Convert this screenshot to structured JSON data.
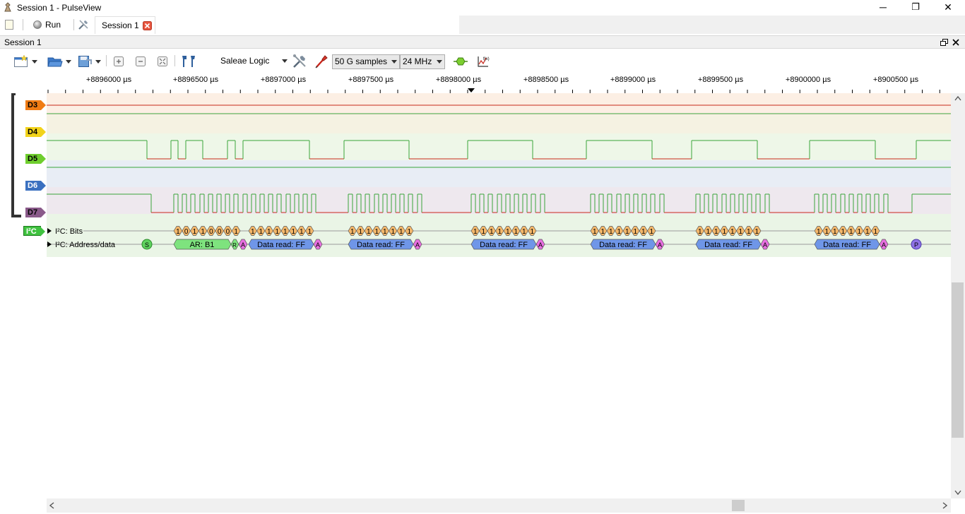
{
  "window": {
    "title": "Session 1 - PulseView",
    "minimize_glyph": "─",
    "restore_glyph": "❐",
    "close_glyph": "✕"
  },
  "tabbar": {
    "run_label": "Run",
    "session_tab_label": "Session 1"
  },
  "session": {
    "header_label": "Session 1"
  },
  "toolbar": {
    "device_label": "Saleae Logic",
    "samples_value": "50 G samples",
    "rate_value": "24 MHz"
  },
  "ruler": {
    "ticks": [
      "+8896000 µs",
      "+8896500 µs",
      "+8897000 µs",
      "+8897500 µs",
      "+8898000 µs",
      "+8898500 µs",
      "+8899000 µs",
      "+8899500 µs",
      "+8900000 µs",
      "+8900500 µs"
    ]
  },
  "channels": [
    {
      "name": "D3",
      "color": "#f07c14"
    },
    {
      "name": "D4",
      "color": "#f2d31a"
    },
    {
      "name": "D5",
      "color": "#6fce2e"
    },
    {
      "name": "D6",
      "color": "#3a70c0"
    },
    {
      "name": "D7",
      "color": "#8a5a8a"
    }
  ],
  "decoder": {
    "name": "I²C",
    "color": "#3fc23f",
    "rows": [
      "I²C: Bits",
      "I²C: Address/data"
    ],
    "start_label": "S",
    "stop_label": "P",
    "ack_label": "A",
    "rw_label": "R",
    "address_label": "AR: B1",
    "address_bits": [
      "1",
      "0",
      "1",
      "1",
      "0",
      "0",
      "0",
      "1"
    ],
    "data_label": "Data read: FF",
    "data_bits": [
      "1",
      "1",
      "1",
      "1",
      "1",
      "1",
      "1",
      "1"
    ],
    "colors": {
      "bits": "#f5b86b",
      "address": "#7ee37e",
      "data": "#6f96e8",
      "ack": "#e76fe0",
      "start": "#5fd25f",
      "stop": "#8f72e6"
    }
  }
}
